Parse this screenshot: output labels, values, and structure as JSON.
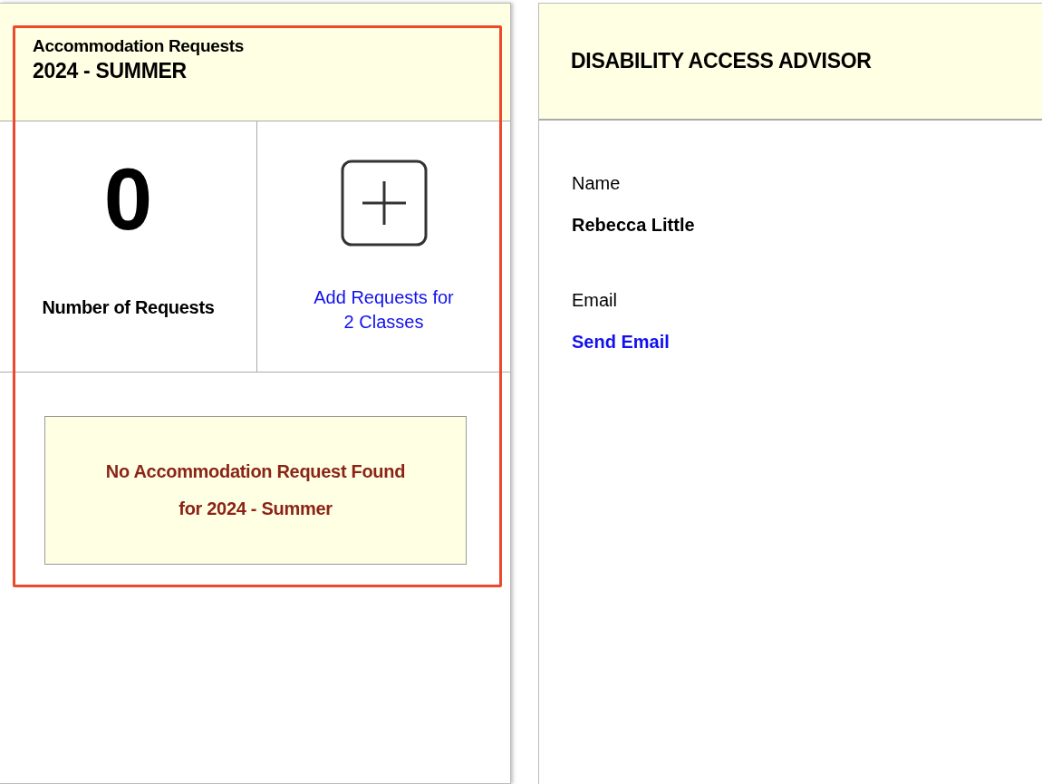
{
  "requests_card": {
    "title": "Accommodation Requests",
    "term": "2024 - SUMMER",
    "highlighted": true,
    "count": "0",
    "count_label": "Number of Requests",
    "add_link": "Add Requests for 2 Classes",
    "empty_message": [
      "No Accommodation Request Found",
      "for 2024 - Summer"
    ]
  },
  "advisor_card": {
    "title": "DISABILITY ACCESS ADVISOR",
    "fields": [
      {
        "label": "Name",
        "value": "Rebecca Little",
        "kind": "text"
      },
      {
        "label": "Email",
        "value": "Send Email",
        "kind": "link"
      }
    ]
  }
}
